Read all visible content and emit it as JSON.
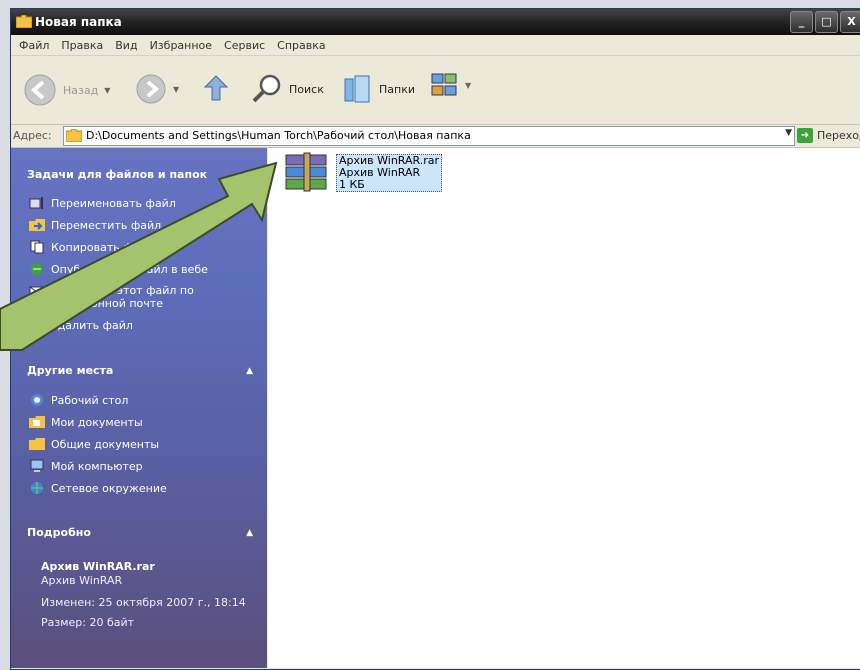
{
  "window": {
    "title": "Новая папка",
    "controls": {
      "minimize": "_",
      "maximize": "□",
      "close": "X"
    }
  },
  "menubar": [
    "Файл",
    "Правка",
    "Вид",
    "Избранное",
    "Сервис",
    "Справка"
  ],
  "toolbar": {
    "back": "Назад",
    "search": "Поиск",
    "folders": "Папки"
  },
  "address": {
    "label": "Адрес:",
    "path": "D:\\Documents and Settings\\Human Torch\\Рабочий стол\\Новая папка",
    "go": "Переход"
  },
  "tasks": {
    "title": "Задачи для файлов и папок",
    "items": [
      {
        "label": "Переименовать файл",
        "icon": "rename-icon"
      },
      {
        "label": "Переместить файл",
        "icon": "move-icon"
      },
      {
        "label": "Копировать файл",
        "icon": "copy-icon"
      },
      {
        "label": "Опубликовать файл в вебе",
        "icon": "publish-web-icon"
      },
      {
        "label": "Отправить этот файл по электронной почте",
        "icon": "email-icon"
      },
      {
        "label": "Удалить файл",
        "icon": "delete-icon"
      }
    ]
  },
  "places": {
    "title": "Другие места",
    "items": [
      {
        "label": "Рабочий стол",
        "icon": "desktop-icon"
      },
      {
        "label": "Мои документы",
        "icon": "my-documents-icon"
      },
      {
        "label": "Общие документы",
        "icon": "shared-documents-icon"
      },
      {
        "label": "Мой компьютер",
        "icon": "my-computer-icon"
      },
      {
        "label": "Сетевое окружение",
        "icon": "network-icon"
      }
    ]
  },
  "details": {
    "title": "Подробно",
    "name": "Архив WinRAR.rar",
    "type": "Архив WinRAR",
    "modified": "Изменен: 25 октября 2007 г., 18:14",
    "size": "Размер: 20 байт"
  },
  "file": {
    "name": "Архив WinRAR.rar",
    "type": "Архив WinRAR",
    "size": "1 КБ",
    "icon": "winrar-archive-icon"
  },
  "colors": {
    "taskpane_top": "#6673c3",
    "taskpane_bottom": "#5b4f7c",
    "arrow_fill": "#a5c26c",
    "selection": "#cbe6fb"
  }
}
